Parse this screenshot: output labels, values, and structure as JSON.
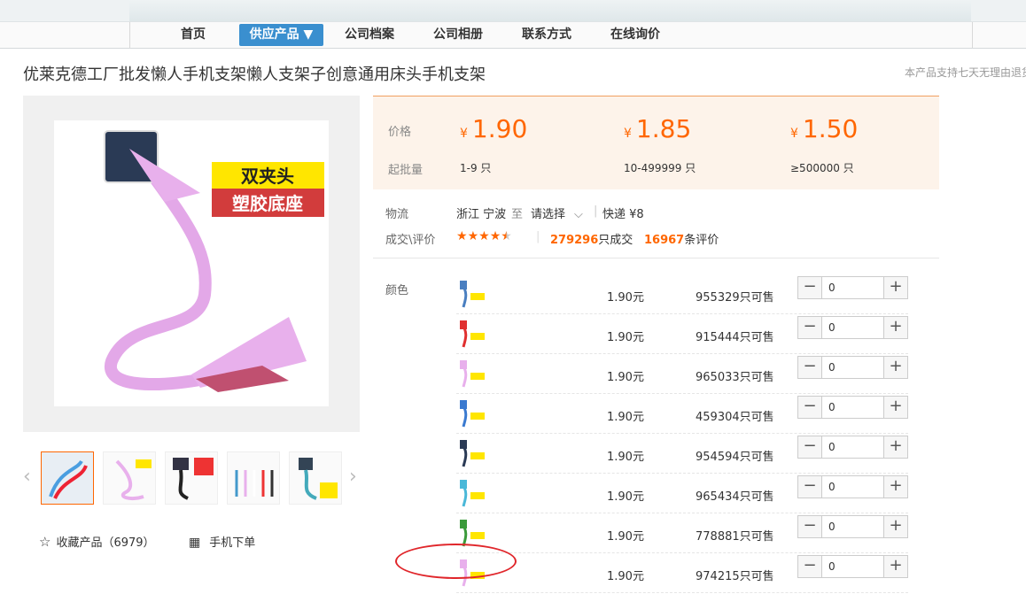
{
  "nav": {
    "items": [
      "首页",
      "供应产品 ▼",
      "公司档案",
      "公司相册",
      "联系方式",
      "在线询价"
    ]
  },
  "product": {
    "title": "优莱克德工厂批发懒人手机支架懒人支架子创意通用床头手机支架",
    "notice": "本产品支持七天无理由退货",
    "image_text_line1": "双夹头",
    "image_text_line2": "塑胶底座"
  },
  "pricing": {
    "price_label": "价格",
    "moq_label": "起批量",
    "tiers": [
      {
        "currency": "¥",
        "price": "1.90",
        "range": "1-9 只"
      },
      {
        "currency": "¥",
        "price": "1.85",
        "range": "10-499999 只"
      },
      {
        "currency": "¥",
        "price": "1.50",
        "range": "≥500000 只"
      }
    ]
  },
  "logistics": {
    "label": "物流",
    "origin": "浙江 宁波",
    "to": "至",
    "destination": "请选择",
    "shipping": "快递 ¥8"
  },
  "reviews": {
    "label": "成交\\评价",
    "rating": 4.5,
    "sold_count": "279296",
    "sold_suffix": "只成交",
    "review_count": "16967",
    "review_suffix": "条评价"
  },
  "sku": {
    "label": "颜色",
    "rows": [
      {
        "price": "1.90元",
        "stock": "955329只可售",
        "qty": "0"
      },
      {
        "price": "1.90元",
        "stock": "915444只可售",
        "qty": "0"
      },
      {
        "price": "1.90元",
        "stock": "965033只可售",
        "qty": "0"
      },
      {
        "price": "1.90元",
        "stock": "459304只可售",
        "qty": "0"
      },
      {
        "price": "1.90元",
        "stock": "954594只可售",
        "qty": "0"
      },
      {
        "price": "1.90元",
        "stock": "965434只可售",
        "qty": "0"
      },
      {
        "price": "1.90元",
        "stock": "778881只可售",
        "qty": "0"
      },
      {
        "price": "1.90元",
        "stock": "974215只可售",
        "qty": "0"
      }
    ]
  },
  "actions": {
    "favorite": "收藏产品（6979）",
    "mobile_order": "手机下单"
  },
  "colors": {
    "accent": "#ff6600",
    "nav_active": "#3a8fcf",
    "price_bg": "#fdf3ea",
    "annotation": "#e0262b"
  }
}
